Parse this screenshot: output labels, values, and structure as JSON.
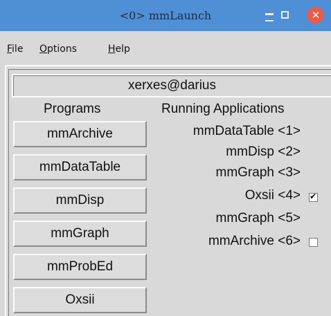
{
  "window": {
    "title": "<0> mmLaunch"
  },
  "menu": {
    "file_letter": "F",
    "file_rest": "ile",
    "options_letter": "O",
    "options_rest": "ptions",
    "help_letter": "H",
    "help_rest": "elp"
  },
  "host": "xerxes@darius",
  "headers": {
    "programs": "Programs",
    "running": "Running Applications"
  },
  "programs": [
    "mmArchive",
    "mmDataTable",
    "mmDisp",
    "mmGraph",
    "mmProbEd",
    "Oxsii"
  ],
  "running": [
    {
      "label": "mmDataTable <1>",
      "has_checkbox": false,
      "checked": false
    },
    {
      "label": "mmDisp <2>",
      "has_checkbox": false,
      "checked": false
    },
    {
      "label": "mmGraph <3>",
      "has_checkbox": false,
      "checked": false
    },
    {
      "label": "Oxsii <4>",
      "has_checkbox": true,
      "checked": true
    },
    {
      "label": "mmGraph <5>",
      "has_checkbox": false,
      "checked": false
    },
    {
      "label": "mmArchive <6>",
      "has_checkbox": true,
      "checked": false
    }
  ],
  "colors": {
    "titlebar": "#4f8fd6",
    "close_button": "#f05a44",
    "background": "#d9d9d9"
  }
}
